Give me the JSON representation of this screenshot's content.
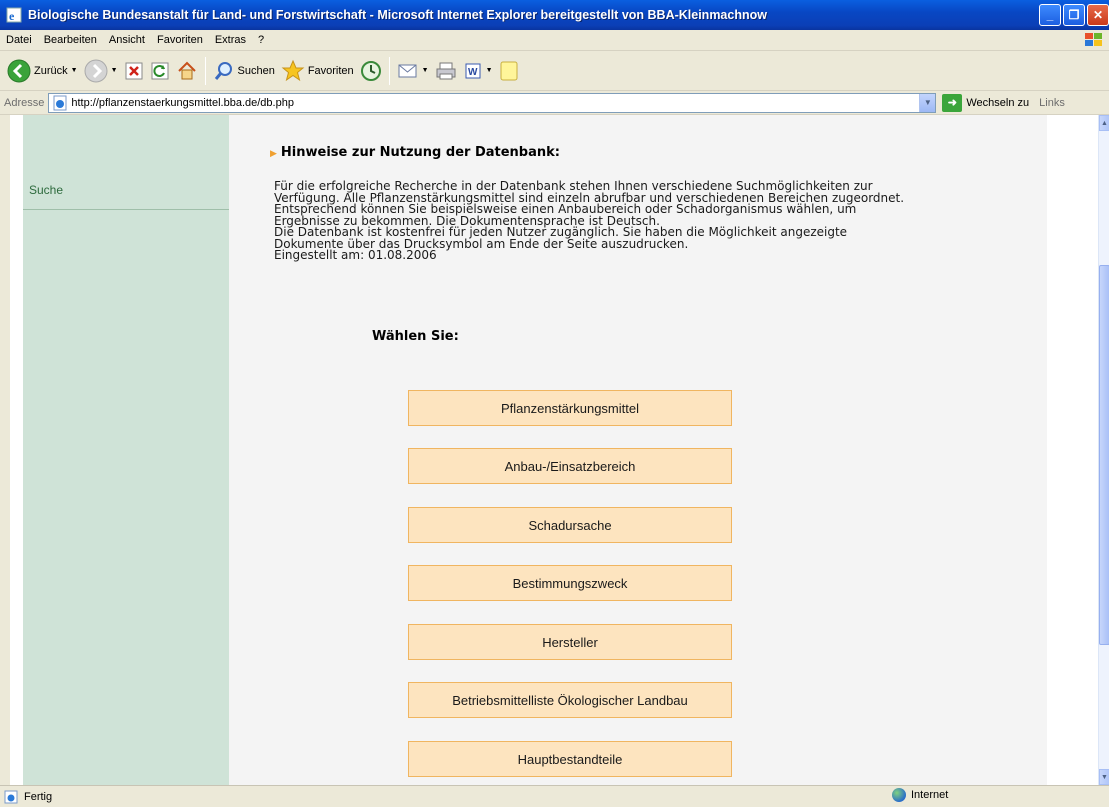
{
  "window": {
    "title": "Biologische Bundesanstalt für Land- und Forstwirtschaft - Microsoft Internet Explorer bereitgestellt von BBA-Kleinmachnow",
    "minimize": "_",
    "maximize": "❐",
    "close": "✕"
  },
  "menu": [
    "Datei",
    "Bearbeiten",
    "Ansicht",
    "Favoriten",
    "Extras",
    "?"
  ],
  "toolbar": {
    "back": "Zurück",
    "search": "Suchen",
    "favorites": "Favoriten"
  },
  "address": {
    "label": "Adresse",
    "url": "http://pflanzenstaerkungsmittel.bba.de/db.php",
    "go": "Wechseln zu",
    "links": "Links"
  },
  "sidebar": {
    "link": "Suche"
  },
  "main": {
    "heading": "Hinweise zur Nutzung der Datenbank:",
    "lines": [
      "Für die erfolgreiche Recherche in der Datenbank stehen Ihnen verschiedene Suchmöglichkeiten zur",
      "Verfügung. Alle Pflanzenstärkungsmittel sind einzeln abrufbar und verschiedenen Bereichen zugeordnet.",
      "Entsprechend können Sie beispielsweise einen Anbaubereich oder Schadorganismus wählen, um",
      "Ergebnisse zu bekommen. Die Dokumentensprache ist Deutsch.",
      "Die Datenbank ist kostenfrei für jeden Nutzer zugänglich. Sie haben die Möglichkeit angezeigte",
      "Dokumente über das Drucksymbol am Ende der Seite auszudrucken.",
      "Eingestellt am: 01.08.2006"
    ],
    "choose": "Wählen Sie:",
    "options": [
      "Pflanzenstärkungsmittel",
      "Anbau-/Einsatzbereich",
      "Schadursache",
      "Bestimmungszweck",
      "Hersteller",
      "Betriebsmittelliste Ökologischer Landbau",
      "Hauptbestandteile"
    ]
  },
  "status": {
    "text": "Fertig",
    "zone": "Internet"
  }
}
